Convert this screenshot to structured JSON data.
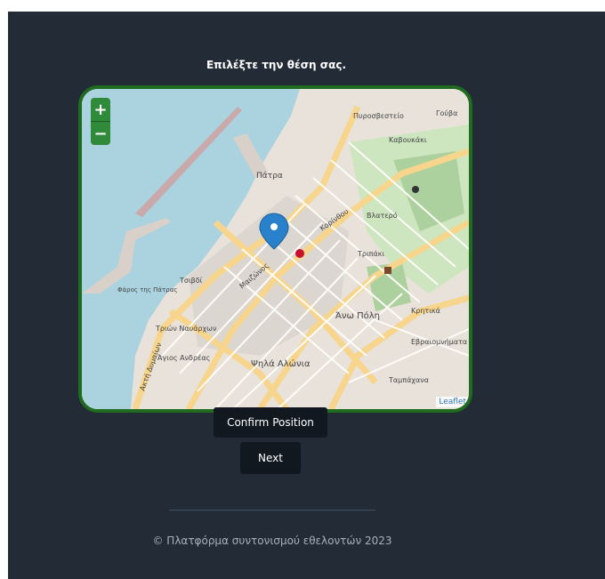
{
  "page": {
    "title": "Επιλέξτε την θέση σας.",
    "footer": "© Πλατφόρμα συντονισμού εθελοντών 2023"
  },
  "map": {
    "zoom_in_label": "+",
    "zoom_out_label": "−",
    "attribution": "Leaflet",
    "labels": {
      "patra": "Πάτρα",
      "pyrosvesteio": "Πυροσβεστείο",
      "tripaki": "Τριπάκι",
      "anw_poli": "Άνω Πόλη",
      "krhtika": "Κρητικά",
      "vlatero": "Βλατερό",
      "evraiomnimata": "Εβραιομνήματα",
      "faros": "Φάρος της Πάτρας",
      "ypsila_alonia": "Ψηλά Αλώνια",
      "agios_andreas": "Άγιος Ανδρέας",
      "trion_navarxon": "Τριών Ναυάρχων",
      "tsivdi": "Τσιβδί",
      "kaboukaki": "Καβουκάκι",
      "gouva": "Γούβα",
      "taboukaki": "Ταμπάχανα",
      "akti_dymaion": "Ακτή Δυμαίων",
      "korinthou": "Κορίνθου",
      "maizonos": "Μαιζώνος"
    }
  },
  "buttons": {
    "confirm": "Confirm Position",
    "next": "Next"
  },
  "colors": {
    "background": "#222b36",
    "map_border": "#1f6b1f",
    "button_bg": "#111820",
    "sea": "#aad3df",
    "marker": "#2a81cb"
  }
}
